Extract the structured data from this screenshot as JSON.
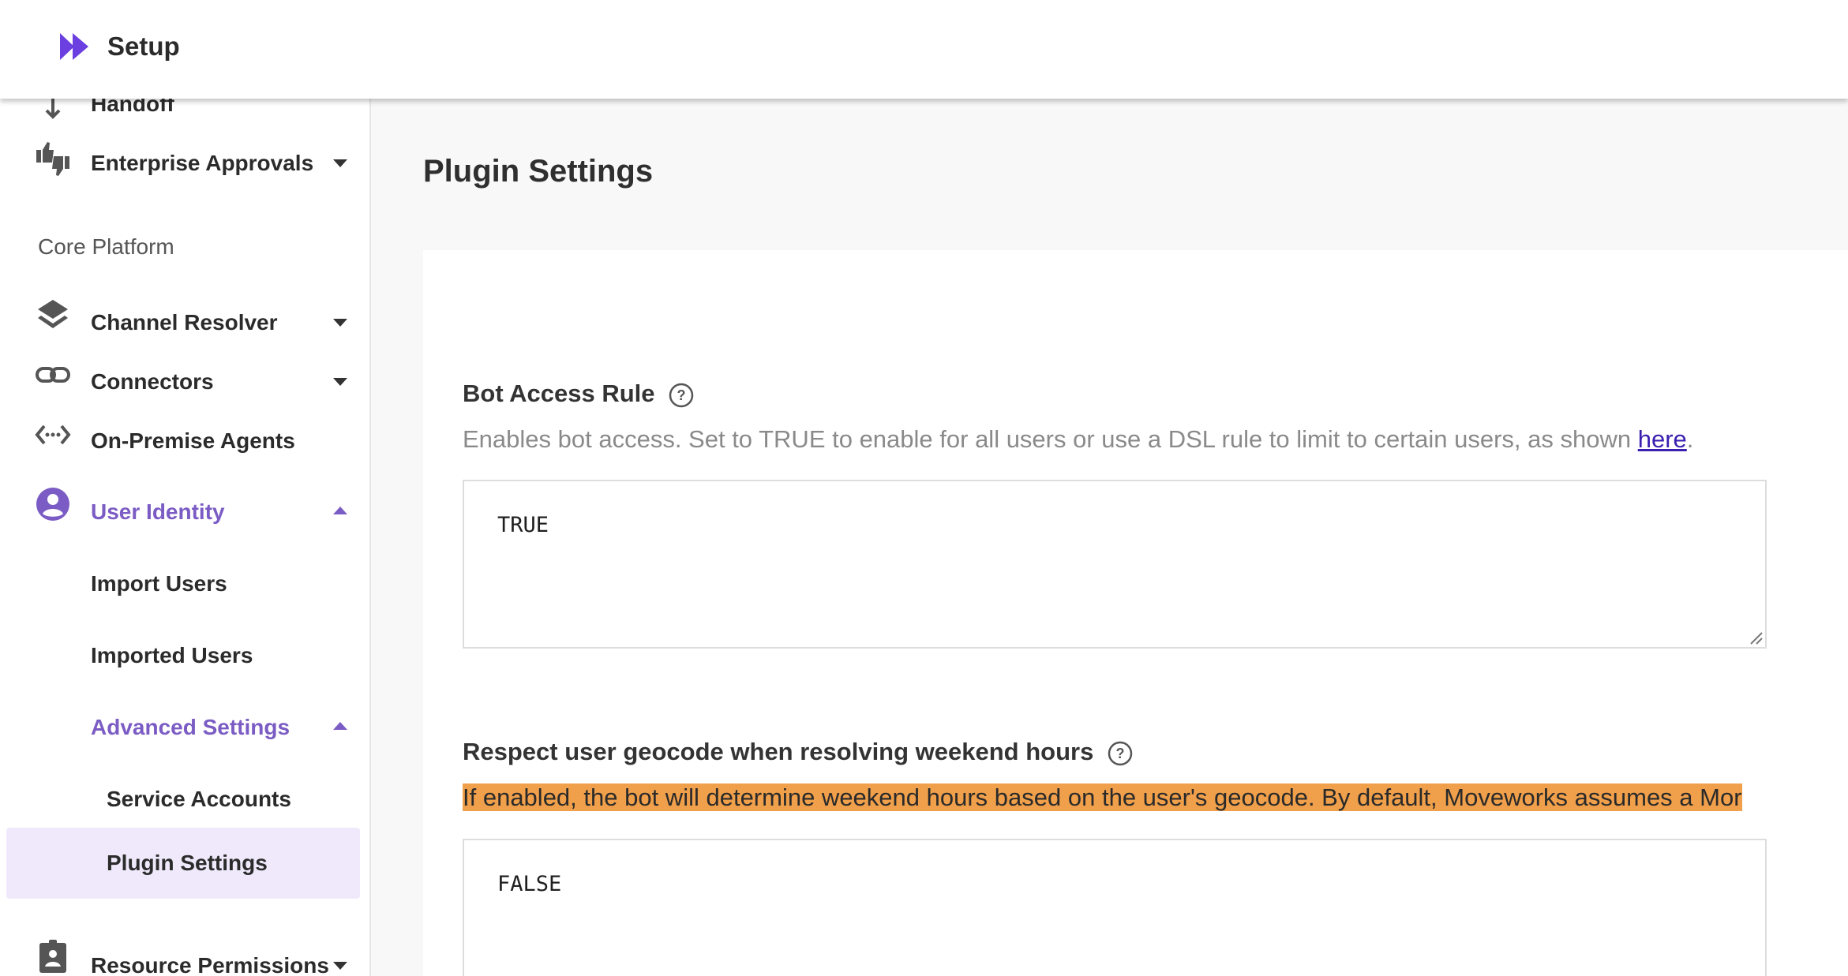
{
  "header": {
    "title": "Setup",
    "logo_color": "#6b3fe0"
  },
  "sidebar": {
    "cut_item": "Handoff",
    "items": [
      {
        "label": "Enterprise Approvals",
        "icon": "thumbs-up-down-icon",
        "caret": "down"
      },
      {
        "label": "Channel Resolver",
        "icon": "layers-icon",
        "caret": "down"
      },
      {
        "label": "Connectors",
        "icon": "link-icon",
        "caret": "down"
      },
      {
        "label": "On-Premise Agents",
        "icon": "code-dots-icon"
      },
      {
        "label": "User Identity",
        "icon": "account-circle-icon",
        "caret": "up",
        "active": true
      },
      {
        "label": "Import Users"
      },
      {
        "label": "Imported Users"
      },
      {
        "label": "Advanced Settings",
        "caret": "up",
        "active": true
      },
      {
        "label": "Service Accounts"
      },
      {
        "label": "Plugin Settings",
        "selected": true
      },
      {
        "label": "Resource Permissions",
        "icon": "badge-icon",
        "caret": "down"
      }
    ],
    "section_label": "Core Platform",
    "accent_color": "#7b5cc4",
    "selected_bg": "#efe9fb"
  },
  "main": {
    "page_title": "Plugin Settings",
    "settings": [
      {
        "title": "Bot Access Rule",
        "description": "Enables bot access. Set to TRUE to enable for all users or use a DSL rule to limit to certain users, as shown ",
        "link_text": "here",
        "trailing": ".",
        "value": "TRUE"
      },
      {
        "title": "Respect user geocode when resolving weekend hours",
        "description": "If enabled, the bot will determine weekend hours based on the user's geocode. By default, Moveworks assumes a Mor",
        "value": "FALSE",
        "highlight_color": "#f0a04b"
      }
    ]
  }
}
